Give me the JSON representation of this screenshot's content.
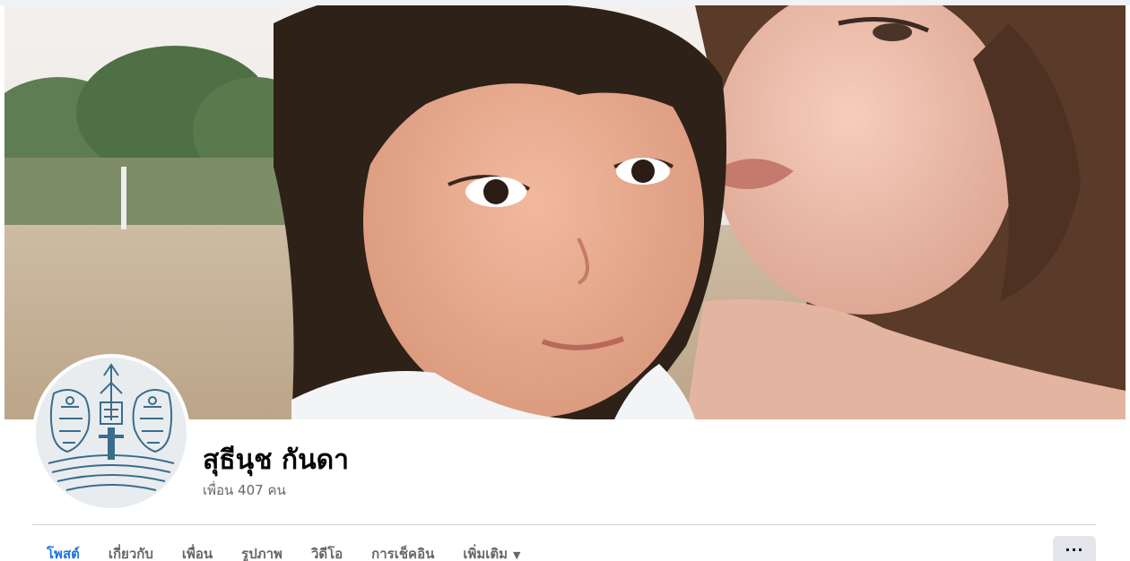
{
  "profile": {
    "name": "สุธีนุช กันดา",
    "friends_label": "เพื่อน 407 คน"
  },
  "tabs": [
    {
      "label": "โพสต์",
      "active": true
    },
    {
      "label": "เกี่ยวกับ"
    },
    {
      "label": "เพื่อน"
    },
    {
      "label": "รูปภาพ"
    },
    {
      "label": "วิดีโอ"
    },
    {
      "label": "การเช็คอิน"
    },
    {
      "label": "เพิ่มเติม"
    }
  ],
  "more_button": {
    "label": "···"
  },
  "colors": {
    "accent": "#1b74e4",
    "tab_text": "#65676b",
    "name_text": "#050505"
  },
  "icons": {
    "more_tab_caret": "caret-down-icon",
    "more_button": "ellipsis-icon"
  }
}
